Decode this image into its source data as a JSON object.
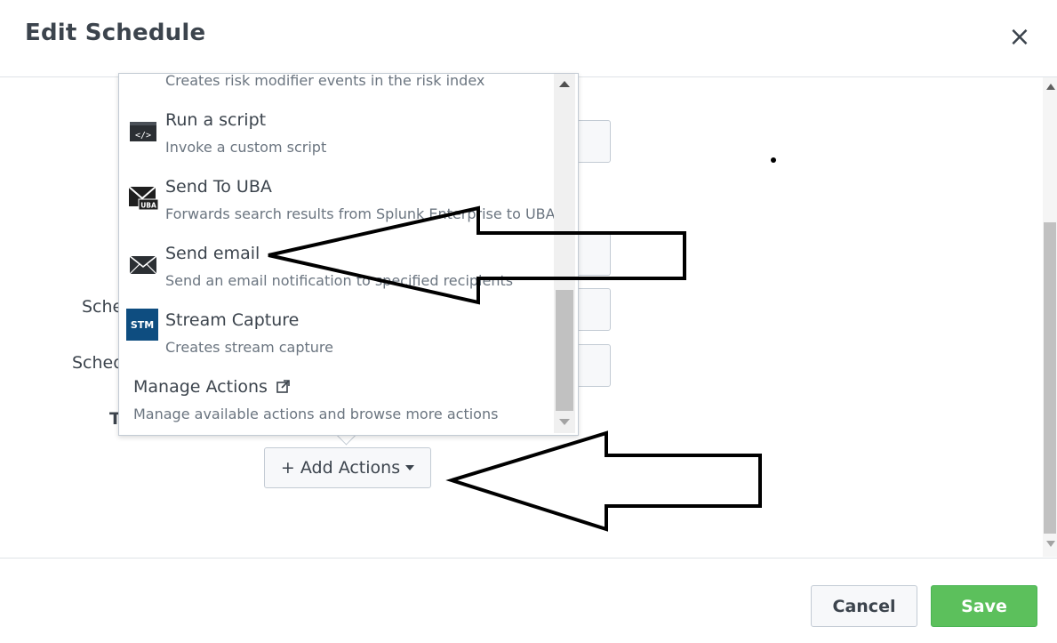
{
  "dialog": {
    "title": "Edit Schedule",
    "close_symbol": "×"
  },
  "form": {
    "labels": [
      "Sche",
      "Sched",
      "T"
    ]
  },
  "add_actions": {
    "label": "+ Add Actions",
    "icon": "caret-down-icon"
  },
  "dropdown": {
    "first_desc": "Creates risk modifier events in the risk index",
    "items": [
      {
        "label": "Run a script",
        "desc": "Invoke a custom script",
        "icon": "script-icon"
      },
      {
        "label": "Send To UBA",
        "desc": "Forwards search results from Splunk Enterprise to UBA",
        "icon": "uba-envelope-icon",
        "icon_text": "UBA"
      },
      {
        "label": "Send email",
        "desc": "Send an email notification to specified recipients",
        "icon": "email-icon"
      },
      {
        "label": "Stream Capture",
        "desc": "Creates stream capture",
        "icon": "stm-icon",
        "icon_text": "STM"
      }
    ],
    "manage": {
      "label": "Manage Actions",
      "icon": "external-link-icon",
      "desc": "Manage available actions and browse more actions"
    }
  },
  "footer": {
    "cancel_label": "Cancel",
    "save_label": "Save"
  },
  "colors": {
    "save_green": "#5cc05c",
    "text": "#3c444d",
    "muted": "#6b7580",
    "stm_blue": "#0e4d80"
  }
}
